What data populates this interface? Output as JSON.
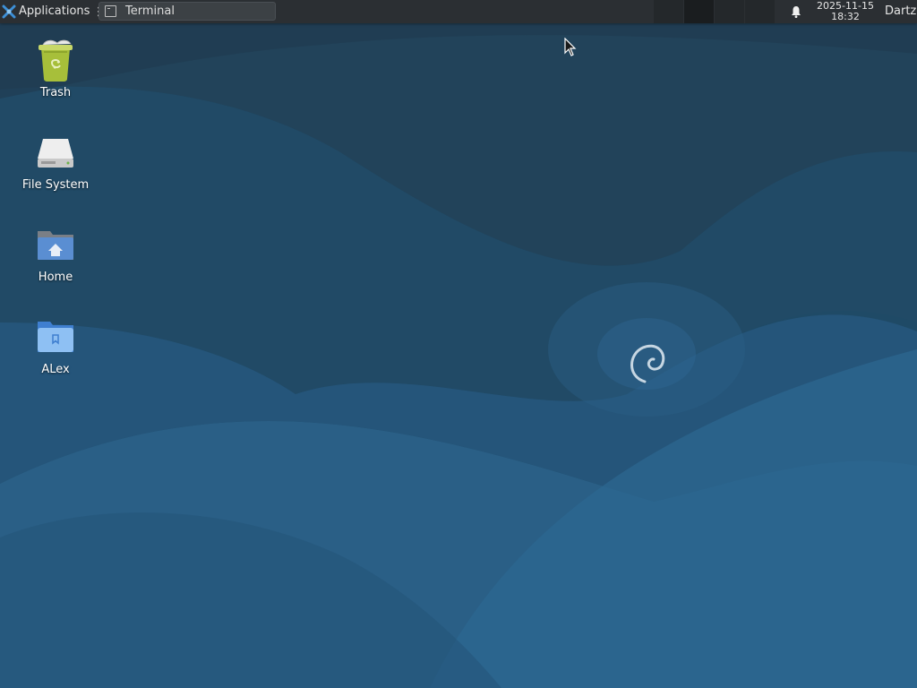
{
  "panel": {
    "applications_label": "Applications",
    "applications_separator": "⋮",
    "task_terminal_label": "Terminal",
    "clock_date": "2025-11-15",
    "clock_time": "18:32",
    "user_label": "Dartz"
  },
  "desktop": {
    "icons": [
      {
        "label": "Trash",
        "icon": "trash-icon"
      },
      {
        "label": "File System",
        "icon": "drive-icon"
      },
      {
        "label": "Home",
        "icon": "home-folder-icon"
      },
      {
        "label": "ALex",
        "icon": "folder-icon"
      }
    ]
  },
  "colors": {
    "panel_bg": "#2b2f33",
    "wallpaper_base": "#1f4a66",
    "accent_blue": "#4a8fd6",
    "trash_green": "#a7bf3a"
  }
}
